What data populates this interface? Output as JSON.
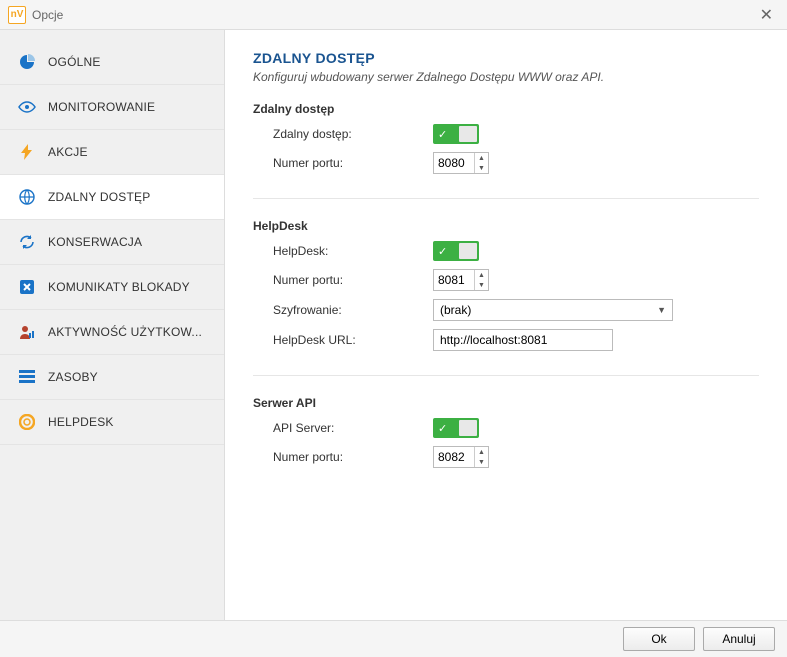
{
  "window": {
    "title": "Opcje"
  },
  "sidebar": {
    "items": [
      {
        "label": "OGÓLNE",
        "icon": "pie-icon",
        "color": "#1a73c7"
      },
      {
        "label": "MONITOROWANIE",
        "icon": "eye-icon",
        "color": "#1a73c7"
      },
      {
        "label": "AKCJE",
        "icon": "bolt-icon",
        "color": "#f5a623"
      },
      {
        "label": "ZDALNY DOSTĘP",
        "icon": "globe-icon",
        "color": "#1a73c7"
      },
      {
        "label": "KONSERWACJA",
        "icon": "refresh-icon",
        "color": "#1a73c7"
      },
      {
        "label": "KOMUNIKATY BLOKADY",
        "icon": "block-icon",
        "color": "#1a73c7"
      },
      {
        "label": "AKTYWNOŚĆ UŻYTKOW...",
        "icon": "user-icon",
        "color": "#b5432e"
      },
      {
        "label": "ZASOBY",
        "icon": "list-icon",
        "color": "#1a73c7"
      },
      {
        "label": "HELPDESK",
        "icon": "lifebuoy-icon",
        "color": "#f5a623"
      }
    ],
    "activeIndex": 3
  },
  "page": {
    "title": "ZDALNY DOSTĘP",
    "subtitle": "Konfiguruj wbudowany serwer Zdalnego Dostępu WWW oraz API."
  },
  "sections": {
    "remote": {
      "title": "Zdalny dostęp",
      "enable_label": "Zdalny dostęp:",
      "port_label": "Numer portu:",
      "port_value": "8080"
    },
    "helpdesk": {
      "title": "HelpDesk",
      "enable_label": "HelpDesk:",
      "port_label": "Numer portu:",
      "port_value": "8081",
      "encryption_label": "Szyfrowanie:",
      "encryption_value": "(brak)",
      "url_label": "HelpDesk URL:",
      "url_value": "http://localhost:8081"
    },
    "api": {
      "title": "Serwer API",
      "enable_label": "API Server:",
      "port_label": "Numer portu:",
      "port_value": "8082"
    }
  },
  "footer": {
    "ok": "Ok",
    "cancel": "Anuluj"
  }
}
